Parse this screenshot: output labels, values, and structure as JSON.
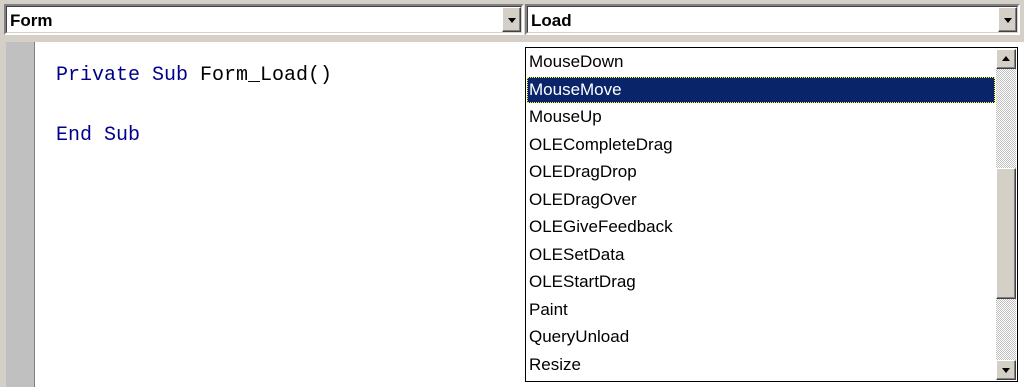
{
  "object_combo": {
    "value": "Form"
  },
  "procedure_combo": {
    "value": "Load"
  },
  "code": {
    "line1_keyword": "Private Sub",
    "line1_name": " Form_Load()",
    "line2": "End Sub"
  },
  "procedure_list": {
    "items": [
      "MouseDown",
      "MouseMove",
      "MouseUp",
      "OLECompleteDrag",
      "OLEDragDrop",
      "OLEDragOver",
      "OLEGiveFeedback",
      "OLESetData",
      "OLEStartDrag",
      "Paint",
      "QueryUnload",
      "Resize"
    ],
    "selected_index": 1,
    "scroll_position": 0.62,
    "visible_fraction": 0.45
  },
  "colors": {
    "keyword": "#00008b",
    "selection": "#0a246a",
    "window_face": "#d4d0c8"
  },
  "icons": {
    "combo_dropdown": "chevron-down-icon",
    "scroll_up": "arrow-up-icon",
    "scroll_down": "arrow-down-icon"
  }
}
